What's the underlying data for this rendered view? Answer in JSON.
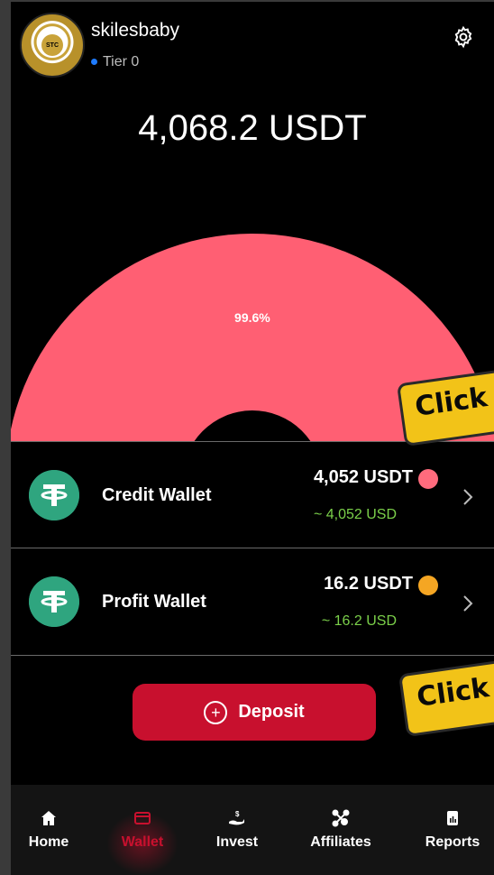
{
  "header": {
    "username": "skilesbaby",
    "tier": "Tier 0",
    "avatar_text": "STC"
  },
  "balance": {
    "total": "4,068.2 USDT"
  },
  "chart_data": {
    "type": "pie",
    "categories": [
      "Credit Wallet",
      "Profit Wallet"
    ],
    "values": [
      4052,
      16.2
    ],
    "colors": [
      "#ff5f73",
      "#f5a623"
    ],
    "labels": [
      "99.6%",
      ""
    ]
  },
  "wallets": [
    {
      "name": "Credit Wallet",
      "amount": "4,052 USDT",
      "usd": "~ 4,052 USD",
      "color": "#ff6b7d"
    },
    {
      "name": "Profit Wallet",
      "amount": "16.2 USDT",
      "usd": "~ 16.2 USD",
      "color": "#f5a623"
    }
  ],
  "deposit": {
    "label": "Deposit"
  },
  "nav": {
    "home": "Home",
    "wallet": "Wallet",
    "invest": "Invest",
    "affiliates": "Affiliates",
    "reports": "Reports"
  },
  "callouts": {
    "first": "Click",
    "second": "Click"
  },
  "icons": {
    "settings": "gear-icon",
    "wallet_token": "tether-icon",
    "chevron": "chevron-right-icon"
  }
}
